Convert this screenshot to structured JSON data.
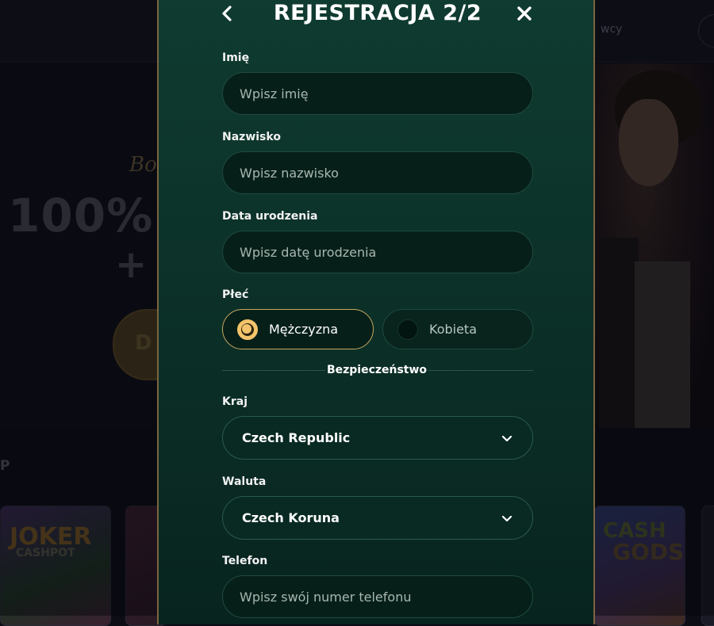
{
  "background": {
    "header_text": "wcy",
    "bonus_script": "Bo",
    "bonus_big": "100% I",
    "bonus_plus": "+",
    "cta_text": "D",
    "section_letter": "P",
    "tile_joker": "JOKER",
    "tile_joker_sub": "CASHPOT",
    "tile_cash": "CASH",
    "tile_gods": "GODS"
  },
  "modal": {
    "title": "REJESTRACJA 2/2",
    "back_icon": "chevron-left-icon",
    "close_icon": "close-icon",
    "first_name": {
      "label": "Imię",
      "placeholder": "Wpisz imię",
      "value": ""
    },
    "last_name": {
      "label": "Nazwisko",
      "placeholder": "Wpisz nazwisko",
      "value": ""
    },
    "birth_date": {
      "label": "Data urodzenia",
      "placeholder": "Wpisz datę urodzenia",
      "value": ""
    },
    "gender": {
      "label": "Płeć",
      "options": [
        {
          "label": "Mężczyzna",
          "selected": true
        },
        {
          "label": "Kobieta",
          "selected": false
        }
      ]
    },
    "security_divider": "Bezpieczeństwo",
    "country": {
      "label": "Kraj",
      "value": "Czech Republic"
    },
    "currency": {
      "label": "Waluta",
      "value": "Czech Koruna"
    },
    "phone": {
      "label": "Telefon",
      "placeholder": "Wpisz swój numer telefonu",
      "value": ""
    }
  },
  "colors": {
    "accent_gold": "#f3c46a",
    "modal_border": "#7a6540",
    "modal_bg": "#0f3b30"
  }
}
